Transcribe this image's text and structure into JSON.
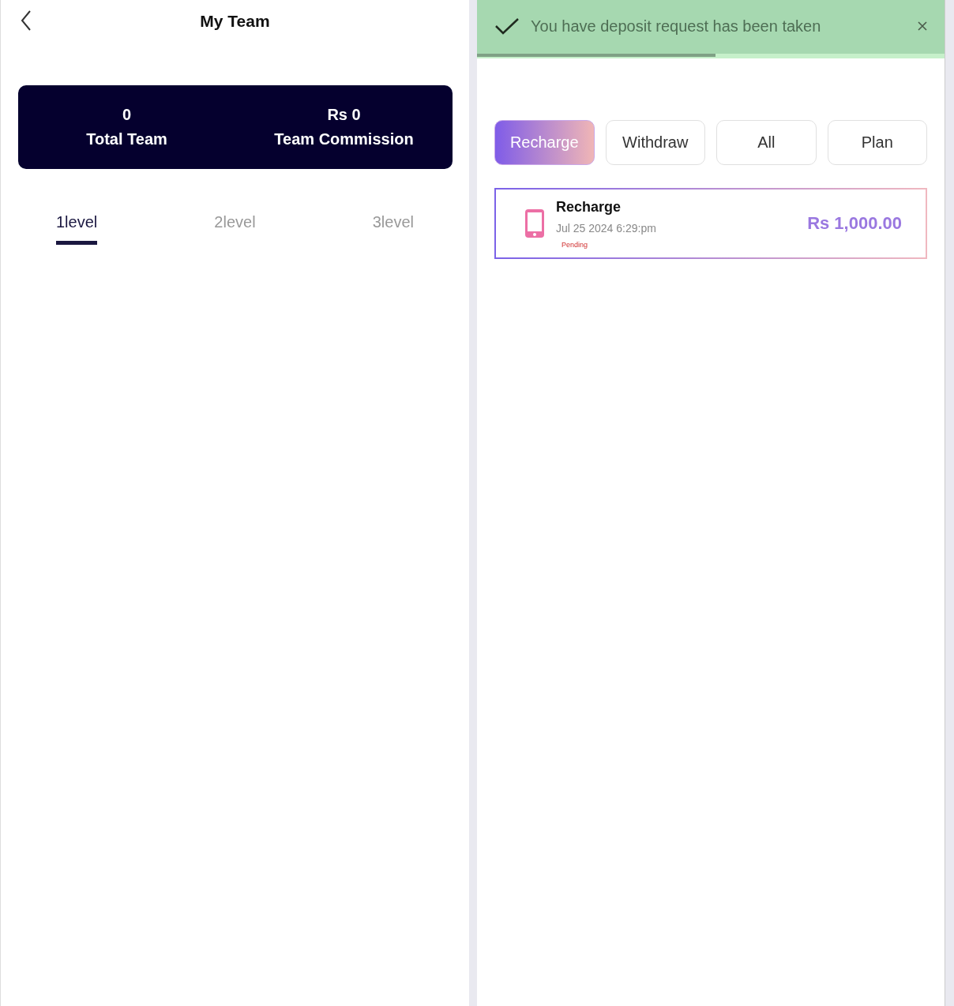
{
  "team_page": {
    "title": "My Team",
    "stats": [
      {
        "value": "0",
        "label": "Total Team"
      },
      {
        "value": "Rs 0",
        "label": "Team Commission"
      }
    ],
    "level_tabs": [
      {
        "label": "1level",
        "selected": true
      },
      {
        "label": "2level",
        "selected": false
      },
      {
        "label": "3level",
        "selected": false
      }
    ]
  },
  "bill_page": {
    "toast": {
      "message": "You have deposit request has been taken",
      "level": 0.51
    },
    "filter_tabs": [
      {
        "label": "Recharge",
        "selected": true
      },
      {
        "label": "Withdraw",
        "selected": false
      },
      {
        "label": "All",
        "selected": false
      },
      {
        "label": "Plan",
        "selected": false
      }
    ],
    "records": [
      {
        "title": "Recharge",
        "date": "Jul 25 2024 6:29:pm",
        "status": "Pending",
        "amount": "Rs 1,000.00"
      }
    ]
  }
}
